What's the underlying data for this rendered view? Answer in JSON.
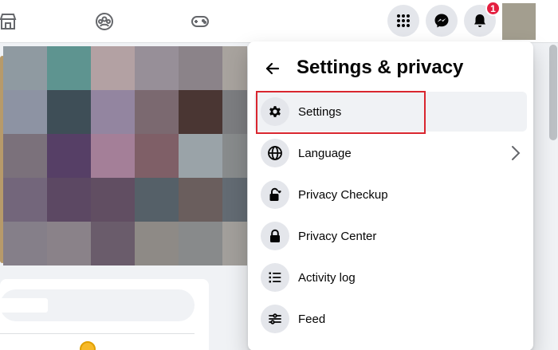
{
  "topbar": {
    "nav_icons": [
      {
        "name": "marketplace-icon"
      },
      {
        "name": "groups-icon"
      },
      {
        "name": "gaming-icon"
      }
    ],
    "right_buttons": [
      {
        "name": "menu-grid-icon"
      },
      {
        "name": "messenger-icon"
      },
      {
        "name": "notifications-bell-icon"
      }
    ],
    "notification_count": "1"
  },
  "menu": {
    "title": "Settings & privacy",
    "items": [
      {
        "label": "Settings",
        "icon": "gear-icon",
        "has_submenu": false
      },
      {
        "label": "Language",
        "icon": "globe-icon",
        "has_submenu": true
      },
      {
        "label": "Privacy Checkup",
        "icon": "lock-heart-icon",
        "has_submenu": false
      },
      {
        "label": "Privacy Center",
        "icon": "lock-icon",
        "has_submenu": false
      },
      {
        "label": "Activity log",
        "icon": "list-icon",
        "has_submenu": false
      },
      {
        "label": "Feed",
        "icon": "sliders-icon",
        "has_submenu": false
      }
    ]
  },
  "colors": {
    "accent_highlight": "#d9262f",
    "badge": "#e41e3f",
    "hover_bg": "#f0f2f5"
  }
}
